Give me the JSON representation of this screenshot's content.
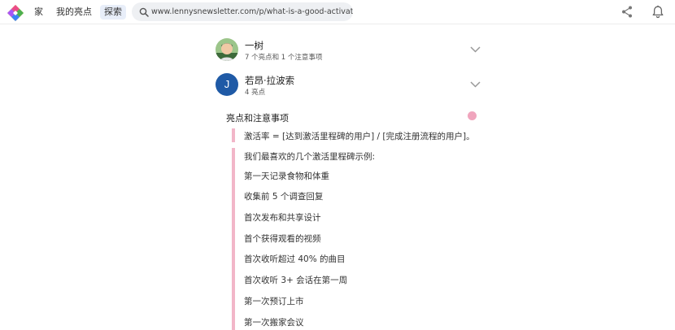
{
  "nav": {
    "home": "家",
    "my_highlights": "我的亮点",
    "explore": "探索"
  },
  "urlbar": {
    "url": "www.lennysnewsletter.com/p/what-is-a-good-activation"
  },
  "users": [
    {
      "name": "一树",
      "summary": "7 个亮点和 1 个注意事项",
      "avatar": "photo"
    },
    {
      "name": "若昂·拉波索",
      "summary": "4 亮点",
      "avatar_initial": "J",
      "avatar_color": "#1f5aa6"
    }
  ],
  "section": {
    "title": "亮点和注意事项",
    "accent_color": "#f2b6c8"
  },
  "highlights": {
    "first": "激活率 = [达到激活里程碑的用户] / [完成注册流程的用户]。",
    "intro": "我们最喜欢的几个激活里程碑示例:",
    "items": [
      "第一天记录食物和体重",
      "收集前 5 个调查回复",
      "首次发布和共享设计",
      "首个获得观看的视频",
      "首次收听超过 40% 的曲目",
      "首次收听 3+ 会话在第一周",
      "第一次预订上市",
      "第一次搬家会议"
    ]
  },
  "icons": {
    "logo": "logo-icon",
    "search": "search-icon",
    "share": "share-icon",
    "bell": "bell-icon",
    "chevron": "chevron-down-icon"
  }
}
